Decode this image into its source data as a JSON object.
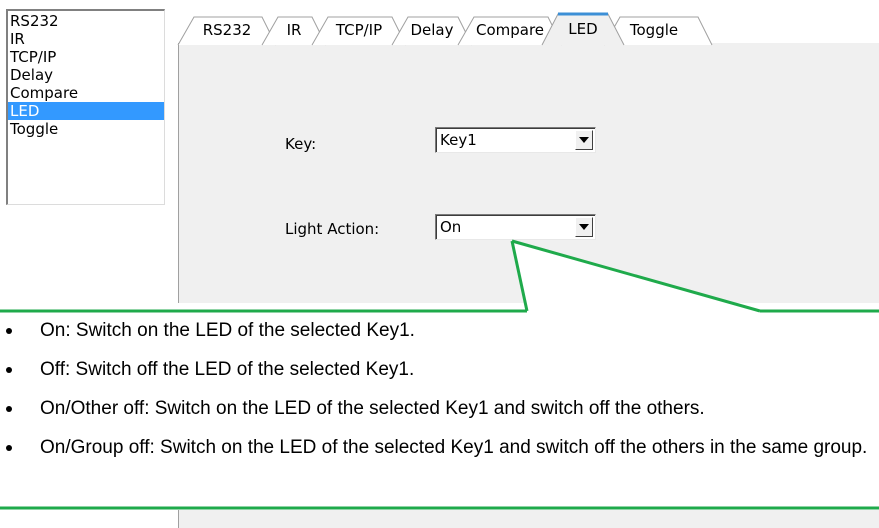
{
  "command_list": {
    "items": [
      {
        "label": "RS232",
        "selected": false
      },
      {
        "label": "IR",
        "selected": false
      },
      {
        "label": "TCP/IP",
        "selected": false
      },
      {
        "label": "Delay",
        "selected": false
      },
      {
        "label": "Compare",
        "selected": false
      },
      {
        "label": "LED",
        "selected": true
      },
      {
        "label": "Toggle",
        "selected": false
      }
    ],
    "selected_color": "#3399ff"
  },
  "tabs": {
    "items": [
      {
        "label": "RS232"
      },
      {
        "label": "IR"
      },
      {
        "label": "TCP/IP"
      },
      {
        "label": "Delay"
      },
      {
        "label": "Compare"
      },
      {
        "label": "LED",
        "active": true
      },
      {
        "label": "Toggle"
      }
    ],
    "active_accent": "#3c8fd6",
    "panel_background": "#f0f0f0"
  },
  "form": {
    "key_label": "Key:",
    "key_value": "Key1",
    "light_action_label": "Light Action:",
    "light_action_value": "On"
  },
  "callout": {
    "border_color": "#1faa4b",
    "bullets": [
      "On: Switch on the LED of the selected Key1.",
      "Off: Switch off the LED of the selected Key1.",
      "On/Other off: Switch on the LED of the selected Key1 and switch off the others.",
      "On/Group off: Switch on the LED of the selected Key1 and switch off the others in the same group."
    ]
  }
}
